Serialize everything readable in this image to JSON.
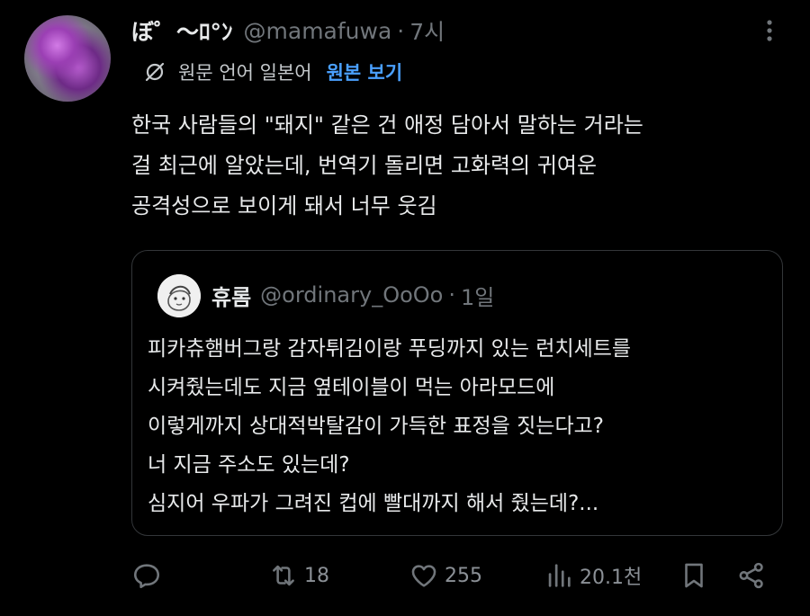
{
  "post": {
    "display_name": "ぼ゜〜ﾛ°ﾝ",
    "handle": "@mamafuwa",
    "separator": "·",
    "time": "7시",
    "translation": {
      "text": "원문 언어 일본어",
      "link": "원본 보기"
    },
    "text_lines": [
      "한국 사람들의 \"돼지\" 같은 건 애정 담아서 말하는 거라는",
      "걸 최근에 알았는데, 번역기 돌리면 고화력의 귀여운",
      "공격성으로 보이게 돼서 너무 웃김"
    ]
  },
  "quote": {
    "display_name": "휴롬",
    "handle": "@ordinary_OoOo",
    "separator": "·",
    "time": "1일",
    "text_lines": [
      "피카츄햄버그랑 감자튀김이랑 푸딩까지 있는 런치세트를",
      "시켜줬는데도 지금 옆테이블이 먹는 아라모드에",
      "이렇게까지 상대적박탈감이 가득한 표정을 짓는다고?",
      "너 지금 주소도 있는데?",
      "심지어 우파가 그려진 컵에 빨대까지 해서 줬는데?..."
    ]
  },
  "actions": {
    "reply": {
      "icon": "reply-icon"
    },
    "repost": {
      "icon": "repost-icon",
      "count": "18"
    },
    "like": {
      "icon": "heart-icon",
      "count": "255"
    },
    "views": {
      "icon": "views-icon",
      "count": "20.1천"
    },
    "bookmark": {
      "icon": "bookmark-icon"
    },
    "share": {
      "icon": "share-icon"
    }
  },
  "colors": {
    "background": "#000000",
    "text": "#e7e9ea",
    "muted": "#71767b",
    "link": "#4aa0ff",
    "border": "#333639"
  }
}
